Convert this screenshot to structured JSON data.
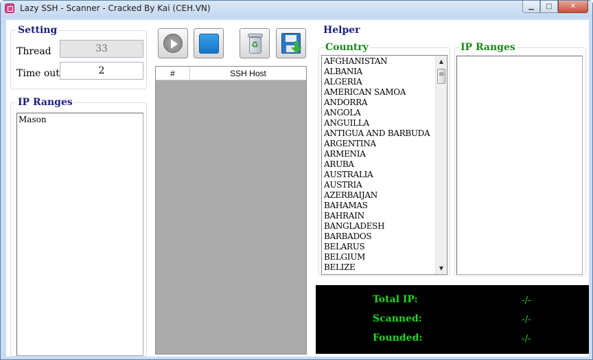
{
  "window": {
    "title": "Lazy SSH - Scanner - Cracked By Kai (CEH.VN)",
    "minimize": "▁",
    "maximize": "□",
    "close": "✕"
  },
  "setting": {
    "legend": "Setting",
    "thread_label": "Thread",
    "thread_value": "33",
    "timeout_label": "Time out",
    "timeout_value": "2"
  },
  "ip_ranges_left": {
    "legend": "IP Ranges",
    "text": "Mason"
  },
  "toolbar": {
    "play_icon": "play-icon",
    "stop_icon": "stop-icon",
    "clear_icon": "recycle-bin-icon",
    "save_icon": "save-icon"
  },
  "host_grid": {
    "col_index": "#",
    "col_host": "SSH Host"
  },
  "helper": {
    "legend": "Helper",
    "country_legend": "Country",
    "ip_ranges_legend": "IP Ranges",
    "countries": [
      "AFGHANISTAN",
      "ALBANIA",
      "ALGERIA",
      "AMERICAN SAMOA",
      "ANDORRA",
      "ANGOLA",
      "ANGUILLA",
      "ANTIGUA AND BARBUDA",
      "ARGENTINA",
      "ARMENIA",
      "ARUBA",
      "AUSTRALIA",
      "AUSTRIA",
      "AZERBAIJAN",
      "BAHAMAS",
      "BAHRAIN",
      "BANGLADESH",
      "BARBADOS",
      "BELARUS",
      "BELGIUM",
      "BELIZE"
    ]
  },
  "stats": {
    "total_label": "Total IP:",
    "total_value": "-/-",
    "scanned_label": "Scanned:",
    "scanned_value": "-/-",
    "founded_label": "Founded:",
    "founded_value": "-/-"
  },
  "colors": {
    "legend_blue": "#1a1f7a",
    "legend_green": "#168a16",
    "stats_text": "#1fd61f",
    "stats_bg": "#000000",
    "grid_bg": "#ababab"
  }
}
